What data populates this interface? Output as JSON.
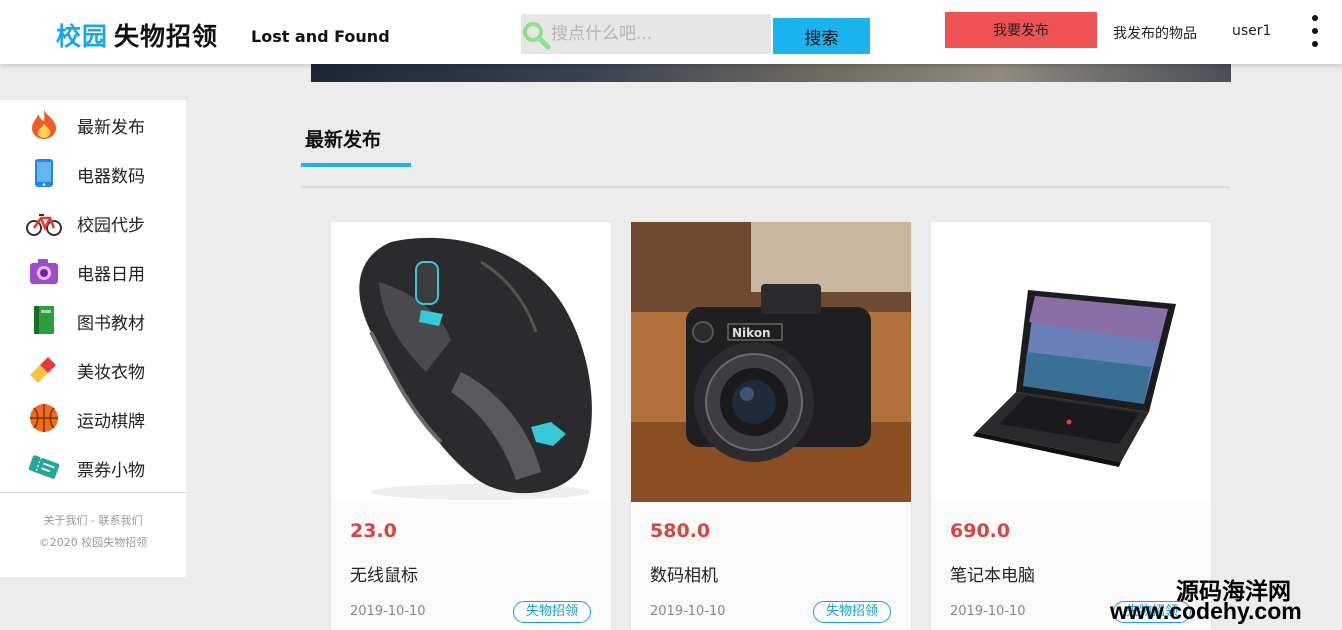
{
  "header": {
    "logo_accent": "校园",
    "logo_rest": "失物招领",
    "logo_en": "Lost and Found",
    "search_placeholder": "搜点什么吧...",
    "search_button": "搜索",
    "publish_button": "我要发布",
    "my_items": "我发布的物品",
    "username": "user1"
  },
  "sidebar": {
    "items": [
      {
        "label": "最新发布",
        "icon": "fire-icon"
      },
      {
        "label": "电器数码",
        "icon": "phone-icon"
      },
      {
        "label": "校园代步",
        "icon": "bicycle-icon"
      },
      {
        "label": "电器日用",
        "icon": "camera-icon"
      },
      {
        "label": "图书教材",
        "icon": "book-icon"
      },
      {
        "label": "美妆衣物",
        "icon": "lipstick-icon"
      },
      {
        "label": "运动棋牌",
        "icon": "basketball-icon"
      },
      {
        "label": "票券小物",
        "icon": "ticket-icon"
      }
    ],
    "footer_links": "关于我们 - 联系我们",
    "footer_copyright": "©2020 校园失物招领"
  },
  "section": {
    "title": "最新发布"
  },
  "cards": [
    {
      "price": "23.0",
      "title": "无线鼠标",
      "date": "2019-10-10",
      "tag": "失物招领",
      "image": "mouse-image"
    },
    {
      "price": "580.0",
      "title": "数码相机",
      "date": "2019-10-10",
      "tag": "失物招领",
      "image": "camera-image"
    },
    {
      "price": "690.0",
      "title": "笔记本电脑",
      "date": "2019-10-10",
      "tag": "失物招领",
      "image": "laptop-image"
    }
  ],
  "watermark": {
    "cn": "源码海洋网",
    "url": "www.codehy.com"
  },
  "colors": {
    "accent": "#19b4ef",
    "publish": "#ee5252",
    "price": "#d9443f"
  }
}
